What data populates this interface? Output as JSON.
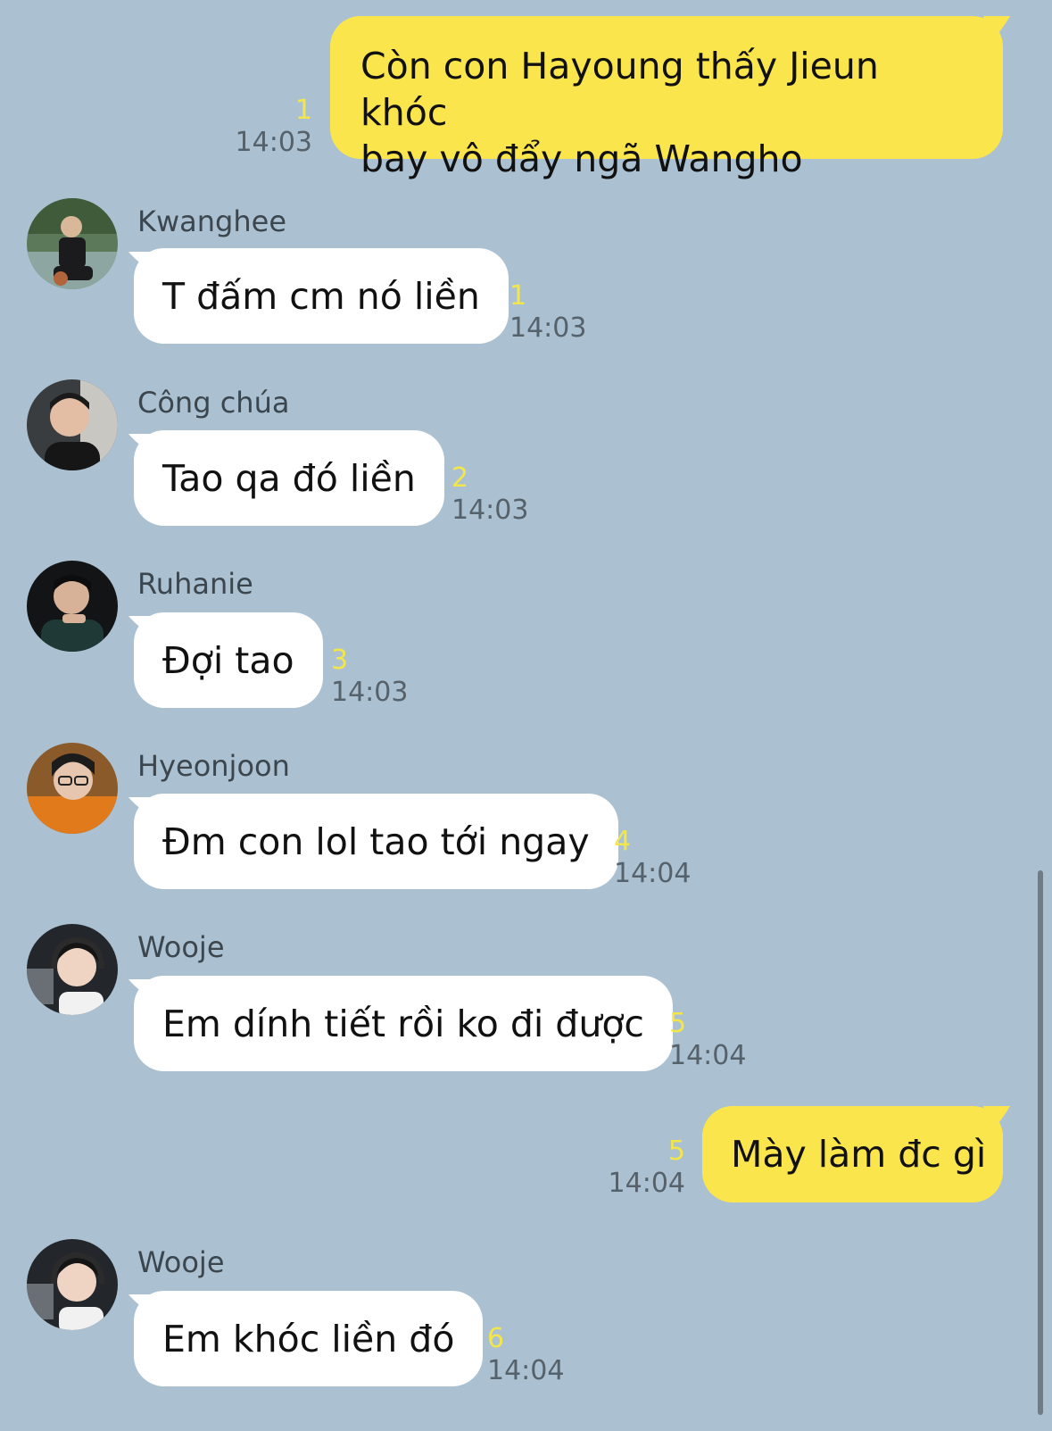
{
  "messages": [
    {
      "kind": "out",
      "text": "Còn con Hayoung thấy Jieun khóc\nbay vô đẩy ngã Wangho",
      "count": "1",
      "time": "14:03"
    },
    {
      "kind": "in",
      "sender": "Kwanghee",
      "text": "T đấm cm nó liền",
      "count": "1",
      "time": "14:03",
      "avatar_icon": "profile-photo-kwanghee"
    },
    {
      "kind": "in",
      "sender": "Công chúa",
      "text": "Tao qa đó liền",
      "count": "2",
      "time": "14:03",
      "avatar_icon": "profile-photo-cong-chua"
    },
    {
      "kind": "in",
      "sender": "Ruhanie",
      "text": "Đợi tao",
      "count": "3",
      "time": "14:03",
      "avatar_icon": "profile-photo-ruhanie"
    },
    {
      "kind": "in",
      "sender": "Hyeonjoon",
      "text": "Đm con lol tao tới ngay",
      "count": "4",
      "time": "14:04",
      "avatar_icon": "profile-photo-hyeonjoon"
    },
    {
      "kind": "in",
      "sender": "Wooje",
      "text": "Em dính tiết rồi ko đi được",
      "count": "5",
      "time": "14:04",
      "avatar_icon": "profile-photo-wooje"
    },
    {
      "kind": "out",
      "text": "Mày làm đc gì",
      "count": "5",
      "time": "14:04"
    },
    {
      "kind": "in",
      "sender": "Wooje",
      "text": "Em khóc liền đó",
      "count": "6",
      "time": "14:04",
      "avatar_icon": "profile-photo-wooje"
    }
  ],
  "colors": {
    "background": "#abc1d1",
    "outgoing_bubble": "#fae54d",
    "incoming_bubble": "#ffffff",
    "unread_count": "#f3e64a",
    "timestamp": "#55616b"
  }
}
